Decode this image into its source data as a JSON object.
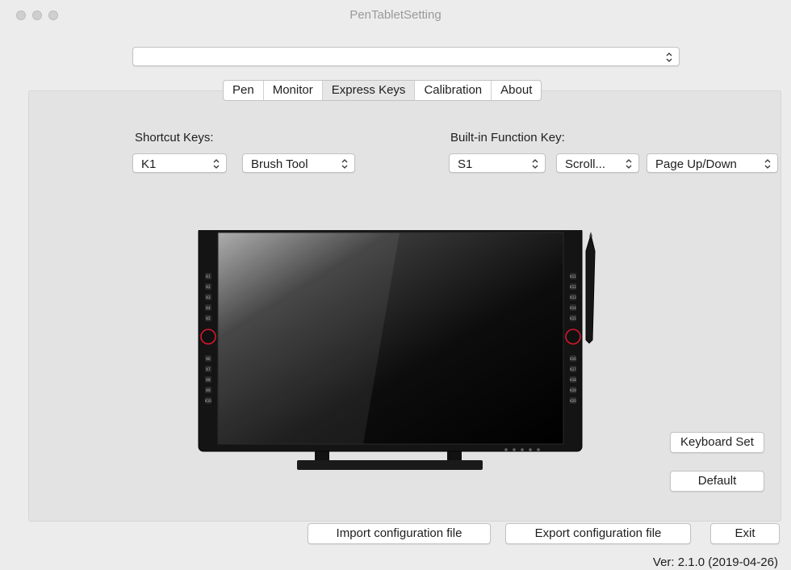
{
  "window": {
    "title": "PenTabletSetting"
  },
  "device_selector": {
    "value": ""
  },
  "tabs": [
    {
      "label": "Pen",
      "active": false
    },
    {
      "label": "Monitor",
      "active": false
    },
    {
      "label": "Express Keys",
      "active": true
    },
    {
      "label": "Calibration",
      "active": false
    },
    {
      "label": "About",
      "active": false
    }
  ],
  "shortcut": {
    "label": "Shortcut Keys:",
    "key_value": "K1",
    "action_value": "Brush Tool"
  },
  "builtin": {
    "label": "Built-in Function Key:",
    "key_value": "S1",
    "mode_value": "Scroll...",
    "function_value": "Page Up/Down"
  },
  "tablet": {
    "left_keys": [
      "K1",
      "K2",
      "K3",
      "K4",
      "K5",
      "K6",
      "K7",
      "K8",
      "K9",
      "K10"
    ],
    "right_keys": [
      "K11",
      "K12",
      "K13",
      "K14",
      "K15",
      "K16",
      "K17",
      "K18",
      "K19",
      "K20"
    ]
  },
  "buttons": {
    "keyboard_set": "Keyboard Set",
    "default": "Default",
    "import": "Import configuration file",
    "export": "Export configuration file",
    "exit": "Exit"
  },
  "version": "Ver: 2.1.0 (2019-04-26)",
  "colors": {
    "window_bg": "#ececec",
    "panel_bg": "#e3e3e3",
    "active_tab": "#e6e6e6",
    "dial_accent": "#d3182a"
  }
}
